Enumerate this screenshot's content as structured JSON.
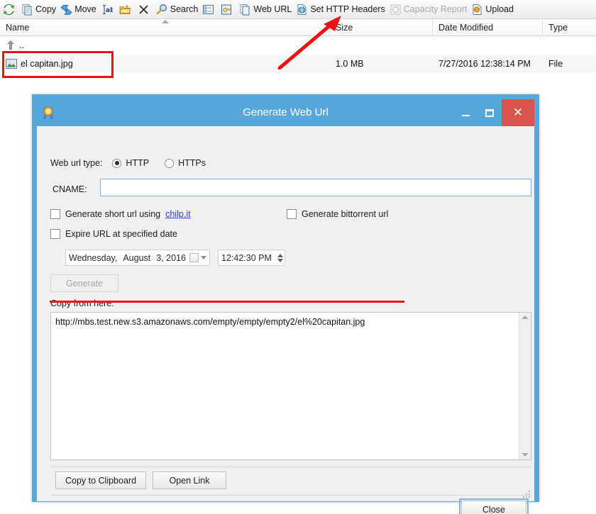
{
  "toolbar": {
    "items": [
      {
        "icon": "refresh-icon",
        "label": "",
        "disabled": false
      },
      {
        "icon": "copy-icon",
        "label": "Copy",
        "disabled": false
      },
      {
        "icon": "move-icon",
        "label": "Move",
        "disabled": false
      },
      {
        "icon": "rename-icon",
        "label": "",
        "disabled": false
      },
      {
        "icon": "new-folder-icon",
        "label": "",
        "disabled": false
      },
      {
        "icon": "delete-icon",
        "label": "",
        "disabled": false
      },
      {
        "icon": "search-icon",
        "label": "Search",
        "disabled": false
      },
      {
        "icon": "properties-icon",
        "label": "",
        "disabled": false
      },
      {
        "icon": "permissions-key-icon",
        "label": "",
        "disabled": false
      },
      {
        "icon": "web-url-icon",
        "label": "Web URL",
        "disabled": false
      },
      {
        "icon": "http-headers-icon",
        "label": "Set HTTP Headers",
        "disabled": false
      },
      {
        "icon": "capacity-report-icon",
        "label": "Capacity Report",
        "disabled": true
      },
      {
        "icon": "upload-icon",
        "label": "Upload",
        "disabled": false
      }
    ]
  },
  "filelist": {
    "columns": [
      {
        "key": "name",
        "label": "Name",
        "sorted": true
      },
      {
        "key": "size",
        "label": "Size",
        "sorted": false
      },
      {
        "key": "date",
        "label": "Date Modified",
        "sorted": false
      },
      {
        "key": "type",
        "label": "Type",
        "sorted": false
      }
    ],
    "rows": [
      {
        "icon": "up-directory-icon",
        "name": "..",
        "size": "",
        "date": "",
        "type": ""
      },
      {
        "icon": "image-file-icon",
        "name": "el capitan.jpg",
        "size": "1.0 MB",
        "date": "7/27/2016 12:38:14 PM",
        "type": "File"
      }
    ]
  },
  "dialog": {
    "title": "Generate Web Url",
    "icon": "medal-icon",
    "window_buttons": {
      "minimize": "minimize-button",
      "maximize": "maximize-button",
      "close": "close-button",
      "close_glyph": "✕"
    },
    "url_type": {
      "label": "Web url type:",
      "options": [
        {
          "label": "HTTP",
          "selected": true
        },
        {
          "label": "HTTPs",
          "selected": false
        }
      ]
    },
    "cname": {
      "label": "CNAME:",
      "value": "",
      "placeholder": ""
    },
    "checkboxes": [
      {
        "label_before": "Generate short url using ",
        "link": "chilp.it",
        "checked": false
      },
      {
        "label_before": "Generate bittorrent url",
        "link": "",
        "checked": false
      },
      {
        "label_before": "Expire URL at specified date",
        "link": "",
        "checked": false
      }
    ],
    "expiry": {
      "date": {
        "weekday": "Wednesday,",
        "month": "August",
        "day_year": "3, 2016"
      },
      "time": "12:42:30 PM"
    },
    "generate_button": {
      "label": "Generate",
      "disabled": true
    },
    "copy_from_label": "Copy from here:",
    "generated_url": "http://mbs.test.new.s3.amazonaws.com/empty/empty/empty2/el%20capitan.jpg",
    "actions": {
      "copy_to_clipboard": "Copy to Clipboard",
      "open_link": "Open Link",
      "close": "Close"
    }
  },
  "annotations": {
    "file_highlight_color": "#ee1111",
    "arrow_color": "#ee1111",
    "url_underline_color": "#ee1111"
  },
  "colors": {
    "dialog_border": "#57a7dd",
    "dialog_close": "#d9534f",
    "dialog_body": "#f0f0f0",
    "link": "#2a3de0",
    "focus_border": "#7eb4ea"
  }
}
